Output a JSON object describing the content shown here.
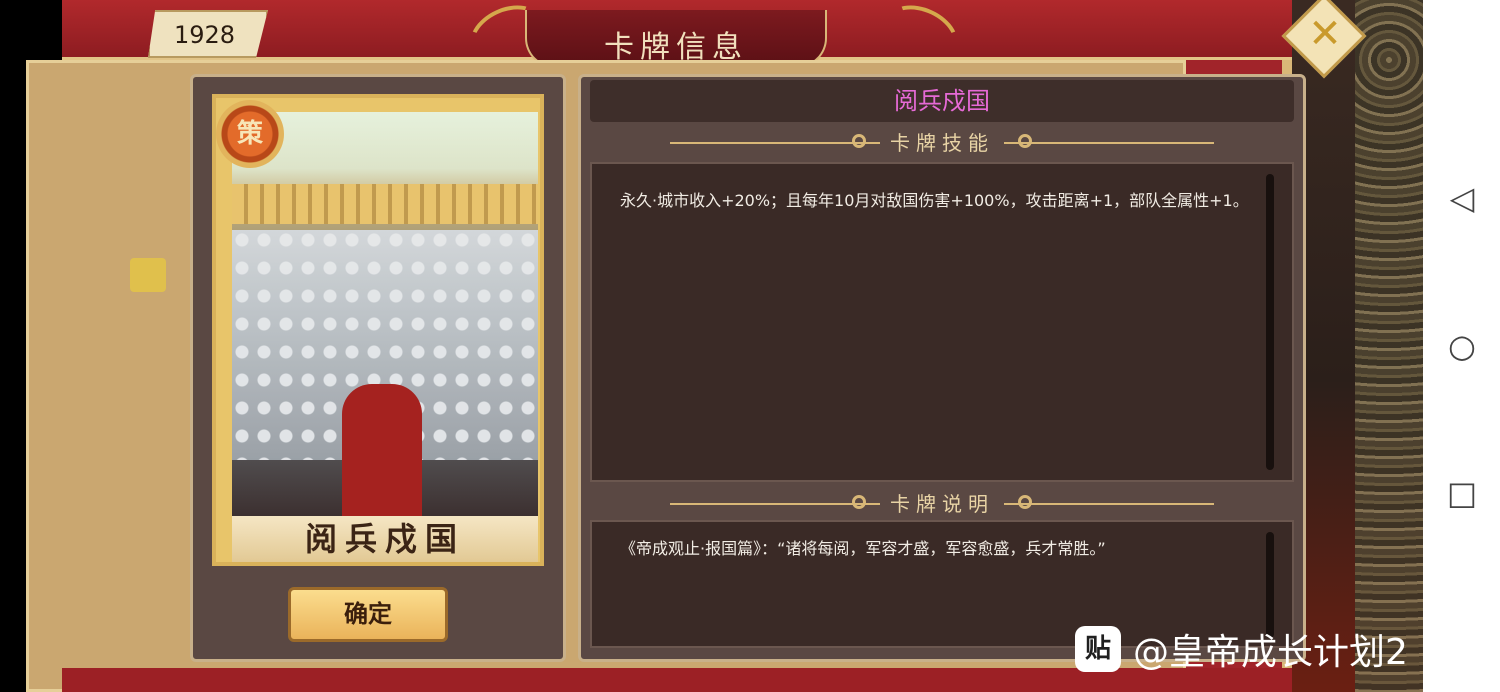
{
  "game": {
    "year": "1928",
    "window_title": "卡牌信息",
    "close_icon": "close-icon",
    "card": {
      "badge_text": "策",
      "name": "阅兵戍国"
    },
    "confirm_label": "确定",
    "card_title": "阅兵戍国",
    "skill_section_title": "卡牌技能",
    "skill_text": "永久·城市收入+20%；且每年10月对敌国伤害+100%，攻击距离+1，部队全属性+1。",
    "desc_section_title": "卡牌说明",
    "desc_text": "《帝成观止·报国篇》：“诸将每阅，军容才盛，军容愈盛，兵才常胜。”",
    "colors": {
      "title_accent": "#e66ad6",
      "frame_red": "#a1242a",
      "gold": "#d9b778"
    }
  },
  "watermark": {
    "logo_text": "贴",
    "text": "@皇帝成长计划2"
  },
  "navbar": {
    "back": "◁",
    "home": "○",
    "recents": "□"
  }
}
